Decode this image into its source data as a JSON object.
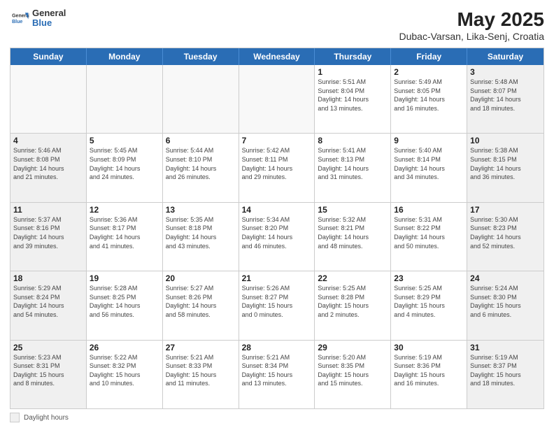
{
  "logo": {
    "general": "General",
    "blue": "Blue"
  },
  "title": "May 2025",
  "subtitle": "Dubac-Varsan, Lika-Senj, Croatia",
  "weekdays": [
    "Sunday",
    "Monday",
    "Tuesday",
    "Wednesday",
    "Thursday",
    "Friday",
    "Saturday"
  ],
  "legend_label": "Daylight hours",
  "weeks": [
    [
      {
        "day": "",
        "info": "",
        "empty": true
      },
      {
        "day": "",
        "info": "",
        "empty": true
      },
      {
        "day": "",
        "info": "",
        "empty": true
      },
      {
        "day": "",
        "info": "",
        "empty": true
      },
      {
        "day": "1",
        "info": "Sunrise: 5:51 AM\nSunset: 8:04 PM\nDaylight: 14 hours\nand 13 minutes.",
        "empty": false
      },
      {
        "day": "2",
        "info": "Sunrise: 5:49 AM\nSunset: 8:05 PM\nDaylight: 14 hours\nand 16 minutes.",
        "empty": false
      },
      {
        "day": "3",
        "info": "Sunrise: 5:48 AM\nSunset: 8:07 PM\nDaylight: 14 hours\nand 18 minutes.",
        "empty": false
      }
    ],
    [
      {
        "day": "4",
        "info": "Sunrise: 5:46 AM\nSunset: 8:08 PM\nDaylight: 14 hours\nand 21 minutes.",
        "empty": false
      },
      {
        "day": "5",
        "info": "Sunrise: 5:45 AM\nSunset: 8:09 PM\nDaylight: 14 hours\nand 24 minutes.",
        "empty": false
      },
      {
        "day": "6",
        "info": "Sunrise: 5:44 AM\nSunset: 8:10 PM\nDaylight: 14 hours\nand 26 minutes.",
        "empty": false
      },
      {
        "day": "7",
        "info": "Sunrise: 5:42 AM\nSunset: 8:11 PM\nDaylight: 14 hours\nand 29 minutes.",
        "empty": false
      },
      {
        "day": "8",
        "info": "Sunrise: 5:41 AM\nSunset: 8:13 PM\nDaylight: 14 hours\nand 31 minutes.",
        "empty": false
      },
      {
        "day": "9",
        "info": "Sunrise: 5:40 AM\nSunset: 8:14 PM\nDaylight: 14 hours\nand 34 minutes.",
        "empty": false
      },
      {
        "day": "10",
        "info": "Sunrise: 5:38 AM\nSunset: 8:15 PM\nDaylight: 14 hours\nand 36 minutes.",
        "empty": false
      }
    ],
    [
      {
        "day": "11",
        "info": "Sunrise: 5:37 AM\nSunset: 8:16 PM\nDaylight: 14 hours\nand 39 minutes.",
        "empty": false
      },
      {
        "day": "12",
        "info": "Sunrise: 5:36 AM\nSunset: 8:17 PM\nDaylight: 14 hours\nand 41 minutes.",
        "empty": false
      },
      {
        "day": "13",
        "info": "Sunrise: 5:35 AM\nSunset: 8:18 PM\nDaylight: 14 hours\nand 43 minutes.",
        "empty": false
      },
      {
        "day": "14",
        "info": "Sunrise: 5:34 AM\nSunset: 8:20 PM\nDaylight: 14 hours\nand 46 minutes.",
        "empty": false
      },
      {
        "day": "15",
        "info": "Sunrise: 5:32 AM\nSunset: 8:21 PM\nDaylight: 14 hours\nand 48 minutes.",
        "empty": false
      },
      {
        "day": "16",
        "info": "Sunrise: 5:31 AM\nSunset: 8:22 PM\nDaylight: 14 hours\nand 50 minutes.",
        "empty": false
      },
      {
        "day": "17",
        "info": "Sunrise: 5:30 AM\nSunset: 8:23 PM\nDaylight: 14 hours\nand 52 minutes.",
        "empty": false
      }
    ],
    [
      {
        "day": "18",
        "info": "Sunrise: 5:29 AM\nSunset: 8:24 PM\nDaylight: 14 hours\nand 54 minutes.",
        "empty": false
      },
      {
        "day": "19",
        "info": "Sunrise: 5:28 AM\nSunset: 8:25 PM\nDaylight: 14 hours\nand 56 minutes.",
        "empty": false
      },
      {
        "day": "20",
        "info": "Sunrise: 5:27 AM\nSunset: 8:26 PM\nDaylight: 14 hours\nand 58 minutes.",
        "empty": false
      },
      {
        "day": "21",
        "info": "Sunrise: 5:26 AM\nSunset: 8:27 PM\nDaylight: 15 hours\nand 0 minutes.",
        "empty": false
      },
      {
        "day": "22",
        "info": "Sunrise: 5:25 AM\nSunset: 8:28 PM\nDaylight: 15 hours\nand 2 minutes.",
        "empty": false
      },
      {
        "day": "23",
        "info": "Sunrise: 5:25 AM\nSunset: 8:29 PM\nDaylight: 15 hours\nand 4 minutes.",
        "empty": false
      },
      {
        "day": "24",
        "info": "Sunrise: 5:24 AM\nSunset: 8:30 PM\nDaylight: 15 hours\nand 6 minutes.",
        "empty": false
      }
    ],
    [
      {
        "day": "25",
        "info": "Sunrise: 5:23 AM\nSunset: 8:31 PM\nDaylight: 15 hours\nand 8 minutes.",
        "empty": false
      },
      {
        "day": "26",
        "info": "Sunrise: 5:22 AM\nSunset: 8:32 PM\nDaylight: 15 hours\nand 10 minutes.",
        "empty": false
      },
      {
        "day": "27",
        "info": "Sunrise: 5:21 AM\nSunset: 8:33 PM\nDaylight: 15 hours\nand 11 minutes.",
        "empty": false
      },
      {
        "day": "28",
        "info": "Sunrise: 5:21 AM\nSunset: 8:34 PM\nDaylight: 15 hours\nand 13 minutes.",
        "empty": false
      },
      {
        "day": "29",
        "info": "Sunrise: 5:20 AM\nSunset: 8:35 PM\nDaylight: 15 hours\nand 15 minutes.",
        "empty": false
      },
      {
        "day": "30",
        "info": "Sunrise: 5:19 AM\nSunset: 8:36 PM\nDaylight: 15 hours\nand 16 minutes.",
        "empty": false
      },
      {
        "day": "31",
        "info": "Sunrise: 5:19 AM\nSunset: 8:37 PM\nDaylight: 15 hours\nand 18 minutes.",
        "empty": false
      }
    ]
  ]
}
